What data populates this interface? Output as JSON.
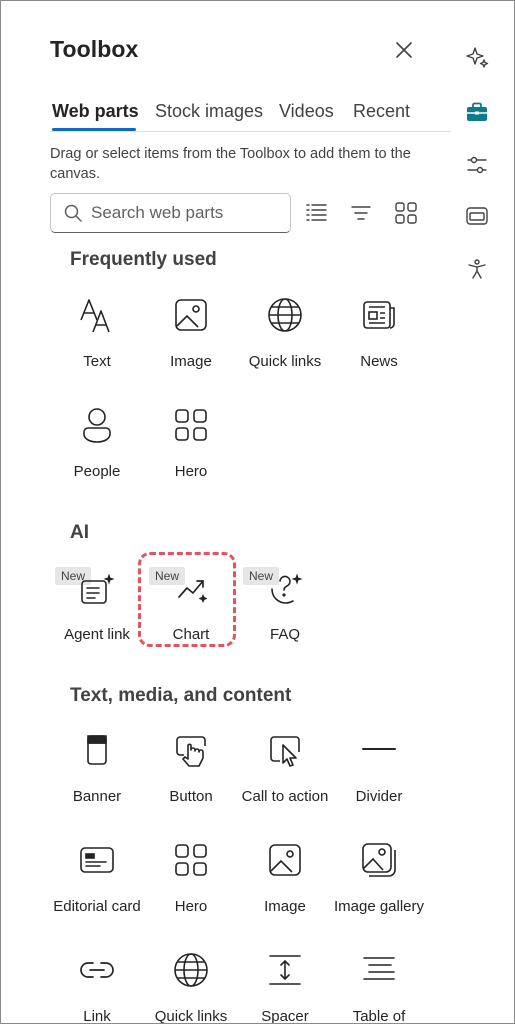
{
  "panel": {
    "title": "Toolbox",
    "description": "Drag or select items from the Toolbox to add them to the canvas."
  },
  "tabs": [
    "Web parts",
    "Stock images",
    "Videos",
    "Recent"
  ],
  "search": {
    "placeholder": "Search web parts"
  },
  "sections": {
    "frequent": {
      "title": "Frequently used",
      "items": [
        "Text",
        "Image",
        "Quick links",
        "News",
        "People",
        "Hero"
      ]
    },
    "ai": {
      "title": "AI",
      "badge": "New",
      "items": [
        "Agent link",
        "Chart",
        "FAQ"
      ]
    },
    "content": {
      "title": "Text, media, and content",
      "items": [
        "Banner",
        "Button",
        "Call to action",
        "Divider",
        "Editorial card",
        "Hero",
        "Image",
        "Image gallery",
        "Link",
        "Quick links",
        "Spacer",
        "Table of"
      ]
    }
  },
  "rail": {
    "icons": [
      "sparkle-icon",
      "toolbox-icon",
      "sliders-icon",
      "layout-icon",
      "accessibility-icon"
    ],
    "accent": "#0f7b8a"
  },
  "colors": {
    "highlight": "#e05561",
    "tab_underline": "#0f6cbd"
  }
}
